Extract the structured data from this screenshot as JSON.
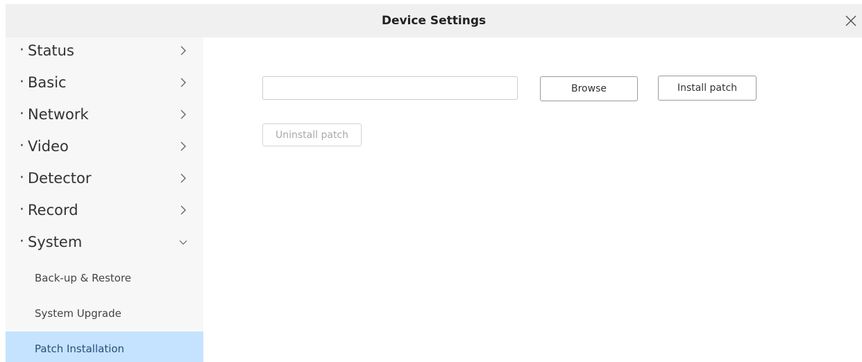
{
  "window": {
    "title": "Device Settings",
    "close_icon": "close-icon"
  },
  "sidebar": {
    "bullet": "·",
    "items": [
      {
        "label": "Status",
        "expanded": false
      },
      {
        "label": "Basic",
        "expanded": false
      },
      {
        "label": "Network",
        "expanded": false
      },
      {
        "label": "Video",
        "expanded": false
      },
      {
        "label": "Detector",
        "expanded": false
      },
      {
        "label": "Record",
        "expanded": false
      },
      {
        "label": "System",
        "expanded": true
      }
    ],
    "subitems": [
      {
        "label": "Back-up & Restore",
        "active": false
      },
      {
        "label": "System Upgrade",
        "active": false
      },
      {
        "label": "Patch Installation",
        "active": true
      }
    ]
  },
  "main": {
    "file_input": {
      "value": "",
      "placeholder": ""
    },
    "browse_label": "Browse",
    "install_label": "Install patch",
    "uninstall_label": "Uninstall patch",
    "uninstall_disabled": true
  },
  "colors": {
    "title_bar": "#f0f0f0",
    "sidebar_bg": "#f7f7f7",
    "active_item_bg": "#c5e3ff",
    "disabled_text": "#a8a8a8"
  }
}
